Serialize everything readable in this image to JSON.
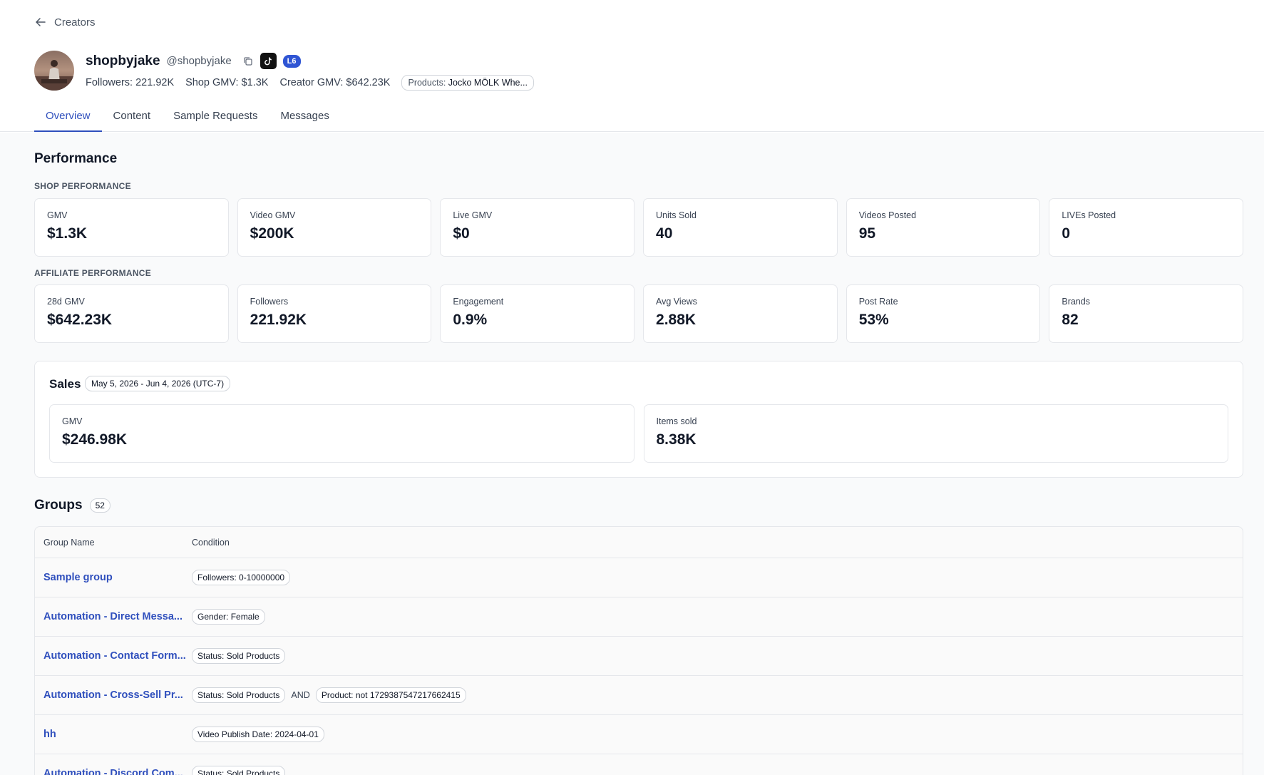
{
  "nav": {
    "back_label": "Creators"
  },
  "creator": {
    "name": "shopbyjake",
    "handle": "@shopbyjake",
    "level": "L6",
    "followers": "Followers: 221.92K",
    "shop_gmv": "Shop GMV: $1.3K",
    "creator_gmv": "Creator GMV: $642.23K",
    "products_label": "Products:",
    "products_value": "Jocko MÖLK Whe..."
  },
  "tabs": [
    "Overview",
    "Content",
    "Sample Requests",
    "Messages"
  ],
  "performance": {
    "title": "Performance",
    "shop_label": "SHOP PERFORMANCE",
    "shop": [
      {
        "label": "GMV",
        "value": "$1.3K"
      },
      {
        "label": "Video GMV",
        "value": "$200K"
      },
      {
        "label": "Live GMV",
        "value": "$0"
      },
      {
        "label": "Units Sold",
        "value": "40"
      },
      {
        "label": "Videos Posted",
        "value": "95"
      },
      {
        "label": "LIVEs Posted",
        "value": "0"
      }
    ],
    "affiliate_label": "AFFILIATE PERFORMANCE",
    "affiliate": [
      {
        "label": "28d GMV",
        "value": "$642.23K"
      },
      {
        "label": "Followers",
        "value": "221.92K"
      },
      {
        "label": "Engagement",
        "value": "0.9%"
      },
      {
        "label": "Avg Views",
        "value": "2.88K"
      },
      {
        "label": "Post Rate",
        "value": "53%"
      },
      {
        "label": "Brands",
        "value": "82"
      }
    ]
  },
  "sales": {
    "title": "Sales",
    "date_range": "May 5, 2026 - Jun 4, 2026 (UTC-7)",
    "cards": [
      {
        "label": "GMV",
        "value": "$246.98K"
      },
      {
        "label": "Items sold",
        "value": "8.38K"
      }
    ]
  },
  "groups": {
    "title": "Groups",
    "count": "52",
    "columns": {
      "name": "Group Name",
      "condition": "Condition"
    },
    "rows": [
      {
        "name": "Sample group",
        "c1": "Followers: 0-10000000",
        "op": "",
        "c2": ""
      },
      {
        "name": "Automation - Direct Messa...",
        "c1": "Gender: Female",
        "op": "",
        "c2": ""
      },
      {
        "name": "Automation - Contact Form...",
        "c1": "Status: Sold Products",
        "op": "",
        "c2": ""
      },
      {
        "name": "Automation - Cross-Sell Pr...",
        "c1": "Status: Sold Products",
        "op": "AND",
        "c2": "Product: not 1729387547217662415"
      },
      {
        "name": "hh",
        "c1": "Video Publish Date: 2024-04-01",
        "op": "",
        "c2": ""
      },
      {
        "name": "Automation - Discord Com...",
        "c1": "Status: Sold Products",
        "op": "",
        "c2": ""
      }
    ]
  }
}
